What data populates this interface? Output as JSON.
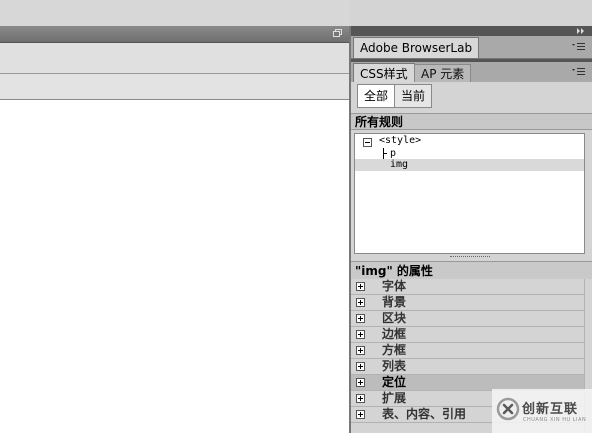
{
  "panels": {
    "browserlab": {
      "tab_label": "Adobe BrowserLab"
    },
    "css": {
      "tabs": [
        {
          "label": "CSS样式",
          "active": true
        },
        {
          "label": "AP 元素",
          "active": false
        }
      ],
      "mode_buttons": [
        {
          "label": "全部",
          "selected": true
        },
        {
          "label": "当前",
          "selected": false
        }
      ],
      "rules_header": "所有规则",
      "rules_tree": [
        {
          "text": "<style>",
          "level": 0,
          "selected": false
        },
        {
          "text": "p",
          "level": 1,
          "selected": false
        },
        {
          "text": "img",
          "level": 1,
          "selected": true
        }
      ],
      "properties_header": "\"img\" 的属性",
      "categories": [
        {
          "label": "字体",
          "selected": false
        },
        {
          "label": "背景",
          "selected": false
        },
        {
          "label": "区块",
          "selected": false
        },
        {
          "label": "边框",
          "selected": false
        },
        {
          "label": "方框",
          "selected": false
        },
        {
          "label": "列表",
          "selected": false
        },
        {
          "label": "定位",
          "selected": true
        },
        {
          "label": "扩展",
          "selected": false
        },
        {
          "label": "表、内容、引用",
          "selected": false
        }
      ]
    }
  },
  "watermark": {
    "brand": "创新互联",
    "subtitle": "CHUANG XIN HU LIAN"
  },
  "colors": {
    "panel_bg": "#d4d4d4",
    "header_bg": "#a9a9a9",
    "dark_strip": "#555555",
    "selected_row": "#bcbcbc"
  }
}
